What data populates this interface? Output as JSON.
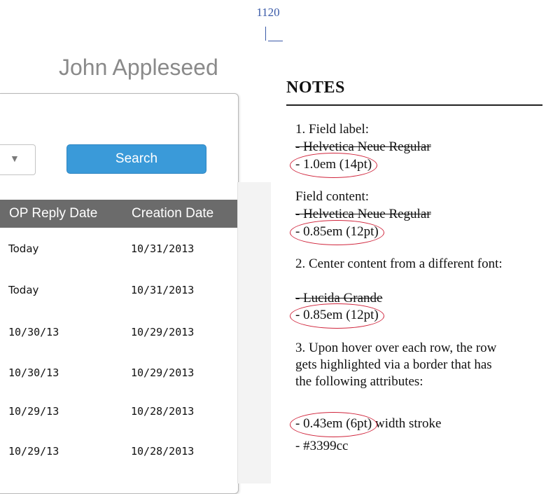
{
  "width_marker": {
    "label": "1120"
  },
  "user": {
    "name": "John Appleseed"
  },
  "toolbar": {
    "dropdown_arrow": "▼",
    "search_label": "Search"
  },
  "table": {
    "headers": {
      "op_reply": "OP Reply Date",
      "created": "Creation Date"
    },
    "rows": [
      {
        "op_reply": "Today",
        "created": "10/31/2013"
      },
      {
        "op_reply": "Today",
        "created": "10/31/2013"
      },
      {
        "op_reply": "10/30/13",
        "created": "10/29/2013"
      },
      {
        "op_reply": "10/30/13",
        "created": "10/29/2013"
      },
      {
        "op_reply": "10/29/13",
        "created": "10/28/2013"
      },
      {
        "op_reply": "10/29/13",
        "created": "10/28/2013"
      }
    ]
  },
  "notes": {
    "title": "NOTES",
    "n1_head": "1.  Field label:",
    "n1_font": "-  Helvetica Neue Regular",
    "n1_size": "- 1.0em (14pt)",
    "fc_head": "Field content:",
    "fc_font": "- Helvetica Neue Regular",
    "fc_size": "- 0.85em (12pt)",
    "n2_head": "2.  Center content from a different font:",
    "n2_font": "- Lucida Grande",
    "n2_size": "- 0.85em (12pt)",
    "n3_line1": "3.  Upon hover over each row, the row",
    "n3_line2": "gets highlighted via a border that has",
    "n3_line3": "the following attributes:",
    "n3_stroke": "- 0.43em (6pt)",
    "n3_stroke_rest": " width stroke",
    "n3_color": "- #3399cc"
  }
}
